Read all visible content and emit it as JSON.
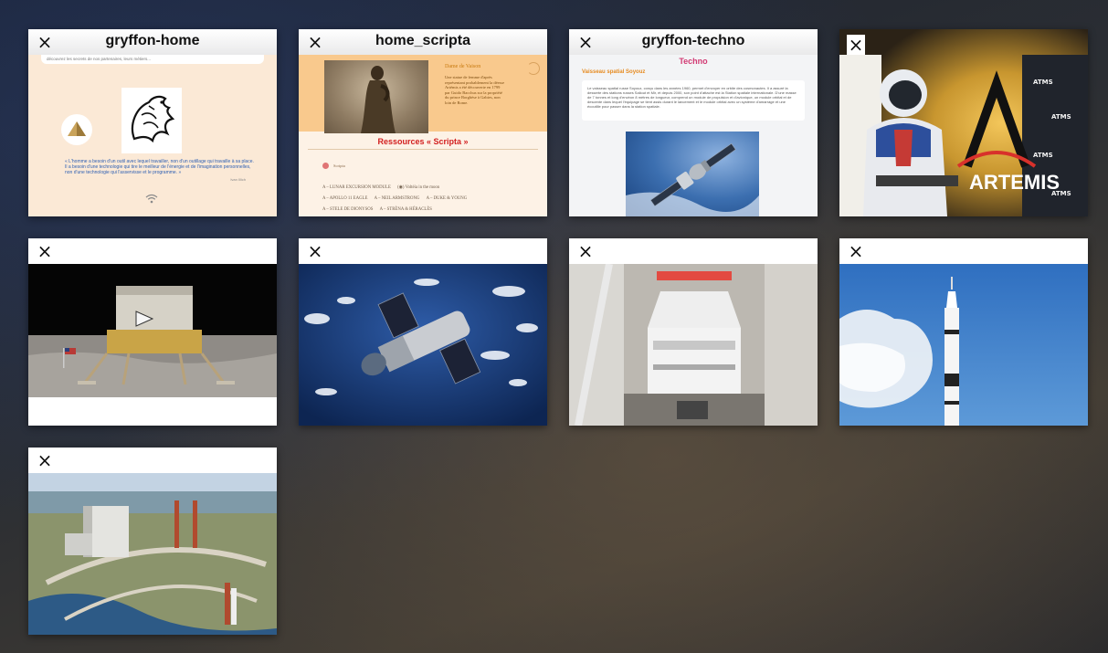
{
  "tabs": [
    {
      "title": "gryffon-home",
      "close_icon": "×",
      "content": {
        "top_snippet": "découvrez les secrets de nos partenaires, leurs métiers...",
        "quote": "« L'homme a besoin d'un outil avec lequel travailler, non d'un outillage qui travaille à sa place. Il a besoin d'une technologie qui tire le meilleur de l'énergie et de l'imagination personnelles, non d'une technologie qui l'asservisse et le programme. »",
        "credit": "Ivan Illich",
        "wifi_icon": "wifi-icon"
      }
    },
    {
      "title": "home_scripta",
      "close_icon": "×",
      "content": {
        "caption_title": "Dame de Vaison",
        "caption": "Une statue de femme d'après représentant probablement la déesse Artémis a été découverte en 1799 par Guido Bacchus sur la propriété du prince Borghèse à Gabies, non loin de Rome.",
        "heading": "Ressources « Scripta »",
        "dot_label": "Scripta",
        "list": [
          [
            "A – LUNAR EXCURSION MODULE",
            "Voltéia in the moon"
          ],
          [
            "A – APOLLO 11 EAGLE",
            "A – NEIL ARMSTRONG",
            "A – DUKE & YOUNG"
          ],
          [
            "A – STELE DE DIONYSOS",
            "A – STRÈNA & HÉRACLÈS"
          ]
        ]
      }
    },
    {
      "title": "gryffon-techno",
      "close_icon": "×",
      "content": {
        "heading": "Techno",
        "subheading": "Vaisseau spatial Soyouz",
        "paragraph": "Le vaisseau spatial russe Soyouz, conçu dans les années 1960, permet d'envoyer en orbite des cosmonautes. Il a assuré la desserte des stations russes Saliout et Mir, et depuis 2000, son point d'attache est la Station spatiale internationale. D'une masse de 7 tonnes et long d'environ 8 mètres de longueur, comprend un module de propulsion et d'avionique, un module orbital et de descente dans lequel l'équipage se tient assis durant le lancement et le module orbital avec un système d'amarrage et une écoutille pour passer dans la station spatiale."
      }
    },
    {
      "title": "",
      "close_icon": "×",
      "image": "astronaut-artemis-photo",
      "logo_text": "ARTEMIS"
    },
    {
      "title": "",
      "close_icon": "×",
      "image": "lunar-module-photo"
    },
    {
      "title": "",
      "close_icon": "×",
      "image": "hubble-telescope-photo"
    },
    {
      "title": "",
      "close_icon": "×",
      "image": "orion-capsule-photo"
    },
    {
      "title": "",
      "close_icon": "×",
      "image": "saturn-v-launch-photo"
    },
    {
      "title": "",
      "close_icon": "×",
      "image": "kennedy-vab-aerial-photo"
    }
  ]
}
